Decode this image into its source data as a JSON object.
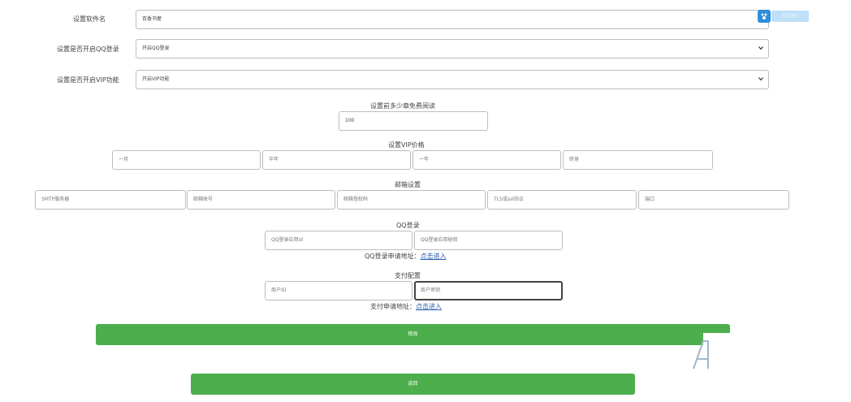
{
  "form": {
    "software_name": {
      "label": "设置软件名",
      "value": "百香书屋"
    },
    "qq_login": {
      "label": "设置是否开启QQ登录",
      "value": "开启QQ登录"
    },
    "vip": {
      "label": "设置是否开启VIP功能",
      "value": "开启VIP功能"
    },
    "free_chapters": {
      "label": "设置前多少章免费阅读",
      "value": "100"
    },
    "vip_price": {
      "label": "设置VIP价格",
      "month_placeholder": "一月",
      "half_year_placeholder": "半年",
      "year_placeholder": "一年",
      "lifetime_placeholder": "终身"
    },
    "mail": {
      "label": "邮箱设置",
      "smtp_placeholder": "SMTP服务器",
      "account_placeholder": "邮箱账号",
      "auth_code_placeholder": "邮箱授权码",
      "tls_placeholder": "TLS或ssl协议",
      "port_placeholder": "端口"
    },
    "qq": {
      "label": "QQ登录",
      "app_id_placeholder": "QQ登录应用id",
      "app_key_placeholder": "QQ登录应用秘钥",
      "apply_text": "QQ登录申请地址：",
      "apply_link": "点击进入"
    },
    "payment": {
      "label": "支付配置",
      "merchant_id_placeholder": "商户ID",
      "merchant_key_placeholder": "商户密钥",
      "apply_text": "支付申请地址：",
      "apply_link": "点击进入"
    }
  },
  "buttons": {
    "modify": "修改",
    "back": "返回"
  },
  "widget": {
    "icon": "baidu-translate-icon",
    "label": "划词翻译"
  },
  "colors": {
    "green": "#4cae4c",
    "link": "#2a5db0",
    "widget_blue": "#2e8fdc"
  }
}
